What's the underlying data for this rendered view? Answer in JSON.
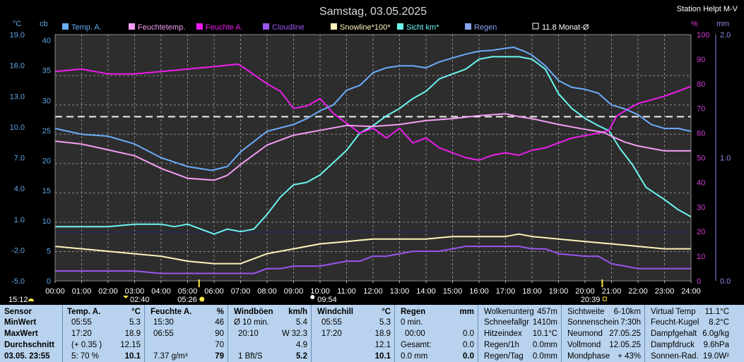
{
  "title": "Samstag, 03.05.2025",
  "station": "Station Helpt M-V",
  "colors": {
    "temp": "#6aacf8",
    "feels": "#f49ef4",
    "hum": "#ee1cee",
    "cloud": "#9a56ee",
    "snow": "#fff4bc",
    "vis": "#6cf6f0",
    "rain": "#8aa4f0",
    "avg": "#eeeeee",
    "axis_left": "#5fa7e6",
    "axis_right": "#d43fd4",
    "axis_rain": "#8a8ae6",
    "dew_line": "#1a1aa8"
  },
  "chart_data": {
    "type": "line",
    "left_axis_c_label": "°C",
    "left_axis_cb_label": "cb",
    "right_axis_pct_label": "%",
    "right_axis_mm_label": "mm",
    "y_c_ticks": [
      "19.0",
      "16.0",
      "13.0",
      "10.0",
      "7.0",
      "4.0",
      "1.0",
      "-2.0",
      "-5.0"
    ],
    "y_cb_ticks": [
      "40",
      "35",
      "30",
      "25",
      "20",
      "15",
      "10",
      "5",
      "0"
    ],
    "y_pct_ticks": [
      "100",
      "90",
      "80",
      "70",
      "60",
      "50",
      "40",
      "30",
      "20",
      "10",
      "0"
    ],
    "y_mm_ticks": [
      "2.0",
      "1.0",
      "0.0"
    ],
    "ylim_c": [
      -5,
      20.2
    ],
    "ylim_pct": [
      0,
      100
    ],
    "x_ticks": [
      "00:00",
      "01:00",
      "02:00",
      "03:00",
      "04:00",
      "05:00",
      "06:00",
      "07:00",
      "08:00",
      "09:00",
      "10:00",
      "11:00",
      "12:00",
      "13:00",
      "14:00",
      "15:00",
      "16:00",
      "17:00",
      "18:00",
      "19:00",
      "20:00",
      "21:00",
      "22:00",
      "23:00",
      "24:00"
    ],
    "legend": [
      {
        "label": "Temp. A.",
        "color_key": "temp"
      },
      {
        "label": "Feuchtetemp.",
        "color_key": "feels"
      },
      {
        "label": "Feuchte A.",
        "color_key": "hum"
      },
      {
        "label": "Cloudline",
        "color_key": "cloud"
      },
      {
        "label": "Snowline*100*",
        "color_key": "snow"
      },
      {
        "label": "Sicht km*",
        "color_key": "vis"
      },
      {
        "label": "Regen",
        "color_key": "rain"
      },
      {
        "label": "11.8 Monat-Ø",
        "color_key": "avg"
      }
    ],
    "month_avg_c": 11.8,
    "dew_ref_c": 0.0,
    "series": [
      {
        "name": "Temp. A.",
        "axis": "c",
        "color_key": "temp",
        "x": [
          0,
          1,
          2,
          3,
          4,
          5,
          5.9,
          6.5,
          7,
          8,
          9,
          9.5,
          10,
          10.5,
          11,
          11.5,
          12,
          12.5,
          13,
          13.5,
          14,
          14.5,
          15,
          15.5,
          16,
          16.5,
          17,
          17.3,
          17.7,
          18,
          18.5,
          19,
          19.5,
          20,
          20.5,
          21,
          21.5,
          22,
          22.5,
          23,
          23.5,
          24
        ],
        "y": [
          10.6,
          10.0,
          9.8,
          9.0,
          7.6,
          6.7,
          6.3,
          6.7,
          8.2,
          10.3,
          11.0,
          11.6,
          12.4,
          13.0,
          14.5,
          15.0,
          16.3,
          16.8,
          17.0,
          17.0,
          16.8,
          17.4,
          17.8,
          18.2,
          18.5,
          18.6,
          18.8,
          18.9,
          18.5,
          18.1,
          17.0,
          15.5,
          14.8,
          14.6,
          14.2,
          13.0,
          12.6,
          12.0,
          11.0,
          10.6,
          10.6,
          10.3
        ]
      },
      {
        "name": "Feuchtetemp.",
        "axis": "c",
        "color_key": "feels",
        "x": [
          0,
          1,
          2,
          3,
          4,
          5,
          5.5,
          6,
          6.5,
          7,
          8,
          9,
          10,
          11,
          12,
          13,
          14,
          15,
          16,
          17,
          17.5,
          18,
          19,
          20,
          20.7,
          21,
          21.5,
          22,
          23,
          24
        ],
        "y": [
          9.3,
          9.0,
          8.4,
          7.8,
          6.5,
          5.5,
          5.4,
          5.3,
          5.8,
          6.9,
          8.9,
          9.9,
          10.4,
          10.9,
          10.8,
          11.0,
          11.4,
          11.6,
          11.9,
          12.1,
          11.8,
          11.6,
          11.0,
          10.5,
          10.2,
          9.8,
          9.2,
          8.8,
          8.3,
          8.3
        ]
      },
      {
        "name": "Feuchte A.",
        "axis": "pct",
        "color_key": "hum",
        "x": [
          0,
          1,
          2,
          3,
          4,
          5,
          6,
          6.9,
          7.2,
          8,
          8.5,
          9,
          9.5,
          10,
          10.5,
          11,
          11.5,
          12,
          12.5,
          13,
          13.5,
          14,
          14.5,
          15,
          15.5,
          16,
          16.5,
          17,
          17.5,
          18,
          18.5,
          19,
          19.5,
          20,
          20.5,
          20.9,
          21.2,
          21.5,
          22,
          23,
          23.5,
          24
        ],
        "y": [
          85,
          86,
          84,
          84,
          85,
          86,
          87,
          88,
          86,
          80,
          77,
          70,
          71,
          74,
          68,
          64,
          60,
          62,
          58,
          62,
          56,
          58,
          54,
          52,
          50,
          49,
          51,
          52,
          51,
          53,
          54,
          56,
          58,
          59,
          60,
          61,
          67,
          69,
          72,
          75,
          77,
          79
        ]
      },
      {
        "name": "Cloudline",
        "axis": "pct",
        "color_key": "cloud",
        "x": [
          0,
          1,
          2,
          3,
          4,
          5,
          6,
          7,
          7.5,
          8,
          8.5,
          9,
          9.5,
          10,
          10.5,
          11,
          11.5,
          12,
          12.5,
          13,
          13.5,
          14,
          14.5,
          15,
          15.5,
          16,
          16.5,
          17,
          17.5,
          18,
          18.5,
          19,
          20,
          20.5,
          21,
          21.5,
          22,
          23,
          24
        ],
        "y": [
          4,
          4,
          4,
          4,
          3,
          3,
          3,
          3,
          3,
          5,
          5,
          6,
          6,
          6,
          7,
          8,
          8,
          10,
          10,
          11,
          12,
          12,
          12,
          13,
          14,
          14,
          14,
          14,
          14,
          13,
          13,
          11,
          10,
          10,
          7,
          6,
          5,
          5,
          5
        ]
      },
      {
        "name": "Snowline*100*",
        "axis": "pct",
        "color_key": "snow",
        "x": [
          0,
          1,
          2,
          3,
          4,
          5,
          6,
          7,
          7.5,
          8,
          9,
          10,
          11,
          12,
          13,
          14,
          15,
          16,
          17,
          17.5,
          18,
          19,
          20,
          21,
          22,
          23,
          24
        ],
        "y": [
          14,
          13,
          12,
          11,
          10,
          8,
          7,
          7,
          9,
          11,
          13,
          15,
          16,
          17,
          17,
          17,
          18,
          18,
          18,
          19,
          18,
          17,
          16,
          15,
          14,
          13,
          13
        ]
      },
      {
        "name": "Sicht km*",
        "axis": "pct",
        "color_key": "vis",
        "x": [
          0,
          1,
          2,
          3,
          4,
          4.5,
          5,
          5.5,
          6,
          6.5,
          7,
          7.5,
          8,
          8.5,
          9,
          9.5,
          10,
          10.5,
          11,
          11.5,
          12,
          12.5,
          13,
          13.5,
          14,
          14.5,
          15,
          15.5,
          16,
          16.5,
          17,
          17.5,
          18,
          18.5,
          19,
          19.5,
          20,
          20.5,
          20.9,
          21.3,
          21.8,
          22.3,
          23,
          23.5,
          24
        ],
        "y": [
          22,
          22,
          22,
          23,
          23,
          22,
          23,
          21,
          19,
          21,
          20,
          21,
          27,
          34,
          39,
          40,
          43,
          48,
          53,
          60,
          63,
          67,
          70,
          74,
          77,
          82,
          84,
          86,
          90,
          91,
          91,
          91,
          90,
          86,
          76,
          70,
          66,
          63,
          61,
          54,
          47,
          38,
          33,
          29,
          26
        ]
      }
    ]
  },
  "markers": {
    "bottom_left_time": "15:12",
    "moon_set": "02:40",
    "sunrise": "05:26",
    "moon_rise": "09:54",
    "sunset": "20:39"
  },
  "table": {
    "labels": {
      "sensor": "Sensor",
      "min": "MinWert",
      "max": "MaxWert",
      "avg": "Durchschnitt",
      "row5": "03.05. 23:55"
    },
    "temp": {
      "h": "Temp. A.",
      "u": "°C",
      "min_t": "05:55",
      "min_v": "5.3",
      "max_t": "17:20",
      "max_v": "18.9",
      "avg_t": "(+ 0.35 )",
      "avg_v": "12.15",
      "r5_t": "5: 70 %",
      "r5_v": "10.1"
    },
    "hum": {
      "h": "Feuchte A.",
      "u": "%",
      "min_t": "15:30",
      "min_v": "46",
      "max_t": "06:55",
      "max_v": "90",
      "avg_v": "70",
      "r5_t": "7.37 g/m³",
      "r5_v": "79"
    },
    "wind": {
      "h": "Windböen",
      "u": "km/h",
      "min_t": "Ø 10 min.",
      "min_v": "5.4",
      "max_t": "20:10",
      "max_d": "W",
      "max_v": "32.3",
      "avg_v": "4.9",
      "r5_t": "1 Bft/S",
      "r5_v": "5.2"
    },
    "chill": {
      "h": "Windchill",
      "u": "°C",
      "min_t": "05:55",
      "min_v": "5.3",
      "max_t": "17:20",
      "max_v": "18.9",
      "avg_v": "12.1",
      "r5_v": "10.1"
    },
    "rain": {
      "h": "Regen",
      "u": "mm",
      "min_t": "0 min.",
      "max_t": "00:00",
      "max_v": "0.0",
      "min_v": "",
      "avg_t": "Gesamt:",
      "avg_v": "0.0",
      "r5_t": "0.0 mm",
      "r5_v": "0.0"
    },
    "info1": [
      {
        "k": "Wolkenunterg",
        "v": "457m"
      },
      {
        "k": "Schneefallgr",
        "v": "1410m"
      },
      {
        "k": "Hitzeindex",
        "v": "10.1°C"
      },
      {
        "k": "Regen/1h",
        "v": "0.0mm"
      },
      {
        "k": "Regen/Tag",
        "v": "0.0mm"
      }
    ],
    "info2": [
      {
        "k": "Sichtweite",
        "v": "6-10km"
      },
      {
        "k": "Sonnenschein",
        "v": "7:30h"
      },
      {
        "k": "Neumond",
        "v": "27.05.25"
      },
      {
        "k": "Vollmond",
        "v": "12.05.25"
      },
      {
        "k": "Mondphase",
        "v": "+ 43%"
      }
    ],
    "info3": [
      {
        "k": "Virtual Temp",
        "v": "11.1°C"
      },
      {
        "k": "Feucht-Kugel",
        "v": "8.2°C"
      },
      {
        "k": "Dampfgehalt",
        "v": "6.0g/kg"
      },
      {
        "k": "Dampfdruck",
        "v": "9.6hPa"
      },
      {
        "k": "Sonnen-Rad.",
        "v": "19.0W²"
      }
    ]
  }
}
